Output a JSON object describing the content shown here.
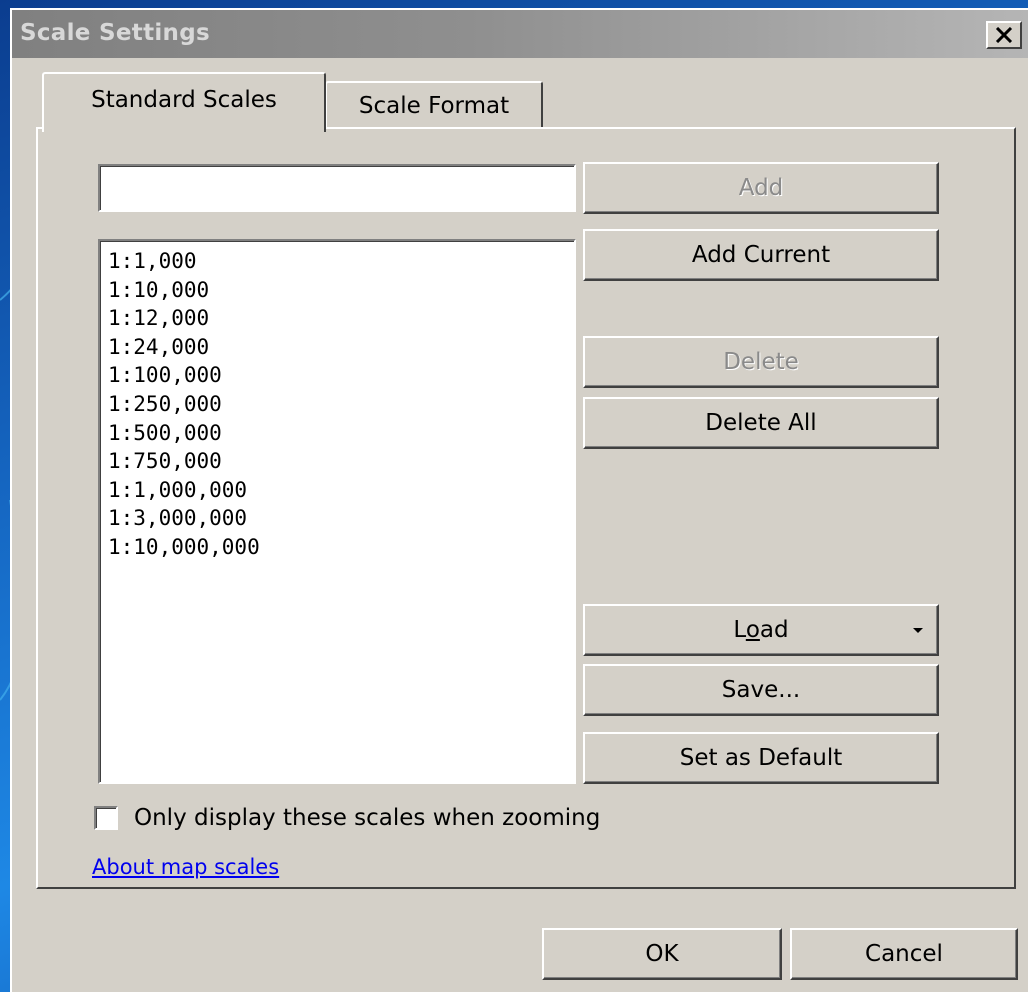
{
  "window": {
    "title": "Scale Settings",
    "close_icon": "close-x-icon"
  },
  "tabs": [
    {
      "label": "Standard Scales",
      "selected": true
    },
    {
      "label": "Scale Format",
      "selected": false
    }
  ],
  "scale_input": {
    "value": ""
  },
  "scales": [
    "1:1,000",
    "1:10,000",
    "1:12,000",
    "1:24,000",
    "1:100,000",
    "1:250,000",
    "1:500,000",
    "1:750,000",
    "1:1,000,000",
    "1:3,000,000",
    "1:10,000,000"
  ],
  "buttons": {
    "add": {
      "label": "Add",
      "enabled": false
    },
    "add_current": {
      "label": "Add Current",
      "enabled": true
    },
    "delete": {
      "label": "Delete",
      "enabled": false
    },
    "delete_all": {
      "label": "Delete All",
      "enabled": true
    },
    "load": {
      "label": "Load",
      "icon": "dropdown-arrow-icon"
    },
    "save": {
      "label": "Save..."
    },
    "set_default": {
      "label": "Set as Default"
    }
  },
  "zoom_option": {
    "label": "Only display these scales when zooming",
    "checked": false
  },
  "about_link": {
    "label": "About map scales"
  },
  "footer": {
    "ok_label": "OK",
    "cancel_label": "Cancel"
  },
  "colors": {
    "dialog_face": "#d4d0c8",
    "titlebar_inactive": "#808080",
    "link": "#0000ee",
    "desktop": "#1565c0"
  }
}
